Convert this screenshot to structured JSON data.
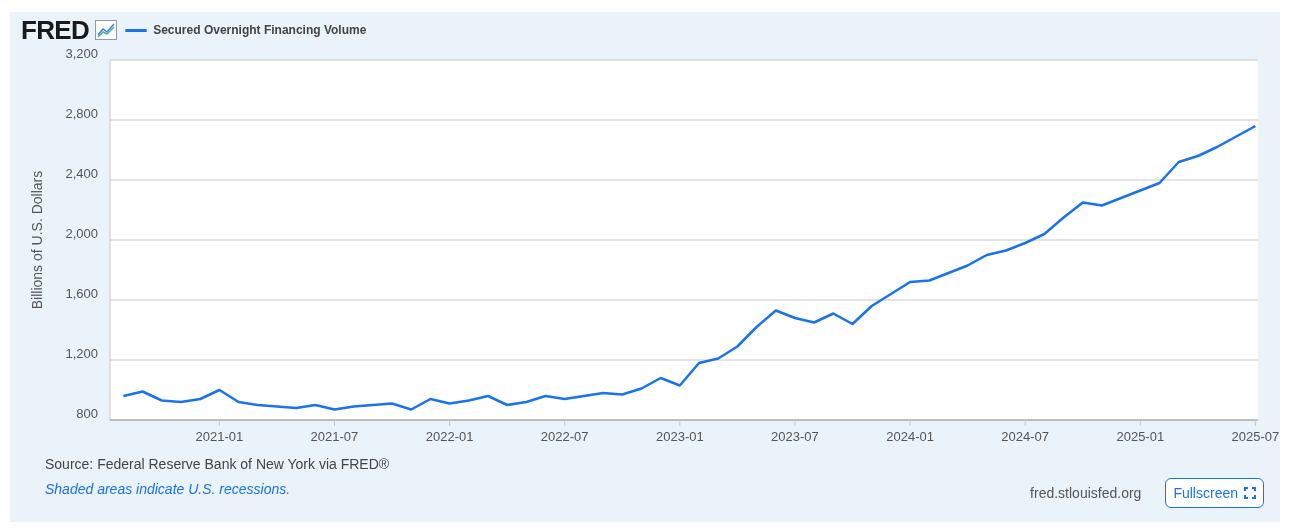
{
  "header": {
    "logo": "FRED"
  },
  "chart_data": {
    "type": "line",
    "ylabel": "Billions of U.S. Dollars",
    "grid": true,
    "xlim": [
      "2020-07-10",
      "2025-07-05"
    ],
    "x": [
      "2020-08",
      "2020-09",
      "2020-10",
      "2020-11",
      "2020-12",
      "2021-01",
      "2021-02",
      "2021-03",
      "2021-04",
      "2021-05",
      "2021-06",
      "2021-07",
      "2021-08",
      "2021-09",
      "2021-10",
      "2021-11",
      "2021-12",
      "2022-01",
      "2022-02",
      "2022-03",
      "2022-04",
      "2022-05",
      "2022-06",
      "2022-07",
      "2022-08",
      "2022-09",
      "2022-10",
      "2022-11",
      "2022-12",
      "2023-01",
      "2023-02",
      "2023-03",
      "2023-04",
      "2023-05",
      "2023-06",
      "2023-07",
      "2023-08",
      "2023-09",
      "2023-10",
      "2023-11",
      "2023-12",
      "2024-01",
      "2024-02",
      "2024-03",
      "2024-04",
      "2024-05",
      "2024-06",
      "2024-07",
      "2024-08",
      "2024-09",
      "2024-10",
      "2024-11",
      "2024-12",
      "2025-01",
      "2025-02",
      "2025-03",
      "2025-04",
      "2025-05",
      "2025-06",
      "2025-07"
    ],
    "series": [
      {
        "name": "Secured Overnight Financing Volume",
        "color": "#1a73e8",
        "values": [
          960,
          990,
          930,
          920,
          940,
          1000,
          920,
          900,
          890,
          880,
          900,
          870,
          890,
          900,
          910,
          870,
          940,
          910,
          930,
          960,
          900,
          920,
          960,
          940,
          960,
          980,
          970,
          1010,
          1080,
          1030,
          1180,
          1210,
          1290,
          1420,
          1530,
          1480,
          1450,
          1510,
          1440,
          1560,
          1640,
          1720,
          1730,
          1780,
          1830,
          1900,
          1930,
          1980,
          2040,
          2150,
          2250,
          2230,
          2280,
          2330,
          2380,
          2520,
          2560,
          2620,
          2690,
          2760
        ]
      }
    ],
    "ylim": [
      800,
      3200
    ],
    "yticks": [
      {
        "value": 800,
        "label": "800"
      },
      {
        "value": 1200,
        "label": "1,200"
      },
      {
        "value": 1600,
        "label": "1,600"
      },
      {
        "value": 2000,
        "label": "2,000"
      },
      {
        "value": 2400,
        "label": "2,400"
      },
      {
        "value": 2800,
        "label": "2,800"
      },
      {
        "value": 3200,
        "label": "3,200"
      }
    ],
    "xticks": [
      {
        "value": "2021-01",
        "label": "2021-01"
      },
      {
        "value": "2021-07",
        "label": "2021-07"
      },
      {
        "value": "2022-01",
        "label": "2022-01"
      },
      {
        "value": "2022-07",
        "label": "2022-07"
      },
      {
        "value": "2023-01",
        "label": "2023-01"
      },
      {
        "value": "2023-07",
        "label": "2023-07"
      },
      {
        "value": "2024-01",
        "label": "2024-01"
      },
      {
        "value": "2024-07",
        "label": "2024-07"
      },
      {
        "value": "2025-01",
        "label": "2025-01"
      },
      {
        "value": "2025-07",
        "label": "2025-07"
      }
    ]
  },
  "footer": {
    "source": "Source: Federal Reserve Bank of New York via FRED®",
    "note": "Shaded areas indicate U.S. recessions.",
    "site": "fred.stlouisfed.org",
    "fullscreen_button": "Fullscreen"
  }
}
